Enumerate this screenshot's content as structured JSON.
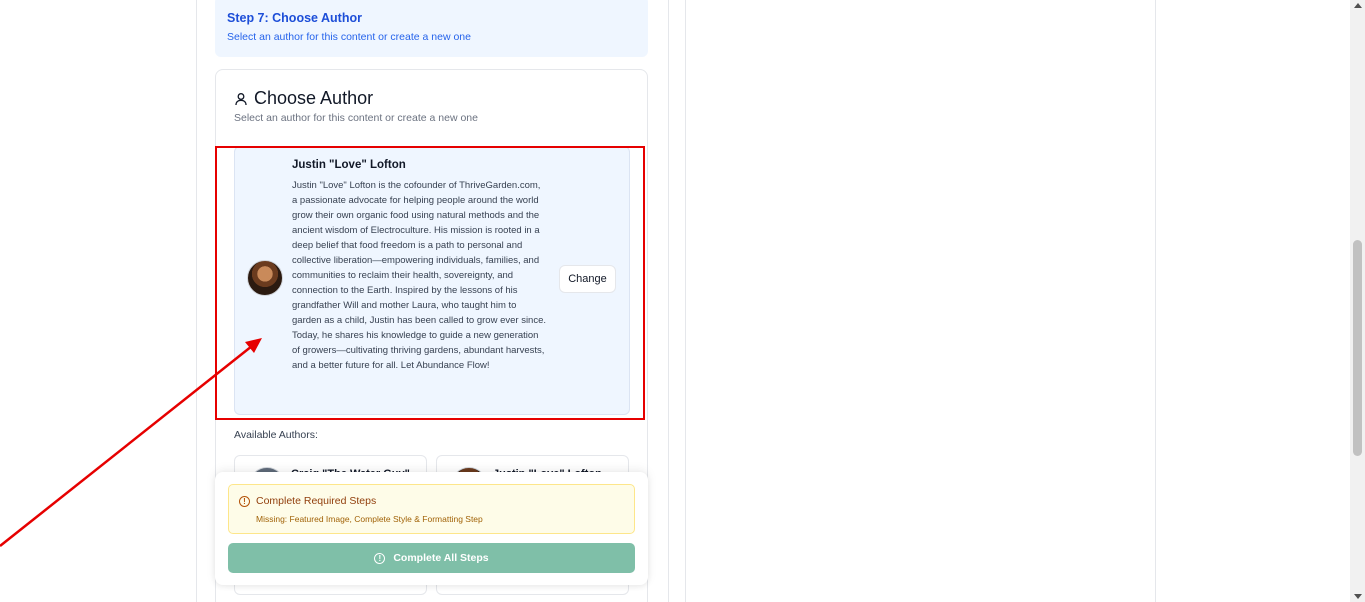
{
  "step": {
    "title": "Step 7: Choose Author",
    "subtitle": "Select an author for this content or create a new one"
  },
  "card": {
    "icon": "user-icon",
    "title": "Choose Author",
    "subtitle": "Select an author for this content or create a new one"
  },
  "selected_author": {
    "name": "Justin \"Love\" Lofton",
    "bio": "Justin \"Love\" Lofton is the cofounder of ThriveGarden.com, a passionate advocate for helping people around the world grow their own organic food using natural methods and the ancient wisdom of Electroculture. His mission is rooted in a deep belief that food freedom is a path to personal and collective liberation—empowering individuals, families, and communities to reclaim their health, sovereignty, and connection to the Earth. Inspired by the lessons of his grandfather Will and mother Laura, who taught him to garden as a child, Justin has been called to grow ever since. Today, he shares his knowledge to guide a new generation of growers—cultivating thriving gardens, abundant harvests, and a better future for all. Let Abundance Flow!",
    "change_label": "Change"
  },
  "available": {
    "label": "Available Authors:",
    "authors": [
      {
        "name": "Craig \"The Water Guy\""
      },
      {
        "name": "Justin \"Love\" Lofton"
      }
    ]
  },
  "footer": {
    "warning_title": "Complete Required Steps",
    "warning_text": "Missing: Featured Image, Complete Style & Formatting Step",
    "button_label": "Complete All Steps"
  },
  "colors": {
    "highlight": "#e60000",
    "accent": "#1d4ed8",
    "button": "#7fbfa8"
  }
}
